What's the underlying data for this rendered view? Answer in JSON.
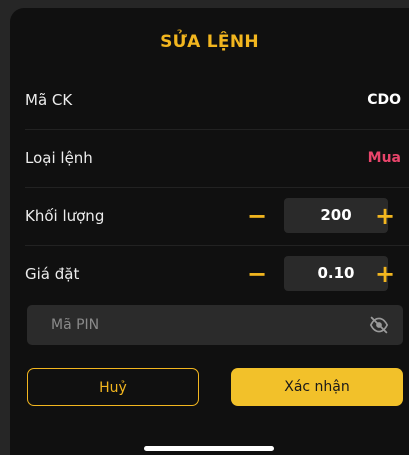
{
  "title": "SỬA LỆNH",
  "rows": {
    "stock_code": {
      "label": "Mã CK",
      "value": "CDO"
    },
    "order_type": {
      "label": "Loại lệnh",
      "value": "Mua"
    },
    "quantity": {
      "label": "Khối lượng",
      "value": "200"
    },
    "price": {
      "label": "Giá đặt",
      "value": "0.10"
    }
  },
  "stepper": {
    "minus": "−",
    "plus": "+"
  },
  "pin": {
    "placeholder": "Mã PIN",
    "icon": "eye-slash-icon"
  },
  "buttons": {
    "cancel": "Huỷ",
    "confirm": "Xác nhận"
  },
  "colors": {
    "accent": "#f2b61f",
    "buy": "#e9456b",
    "background": "#101010"
  }
}
